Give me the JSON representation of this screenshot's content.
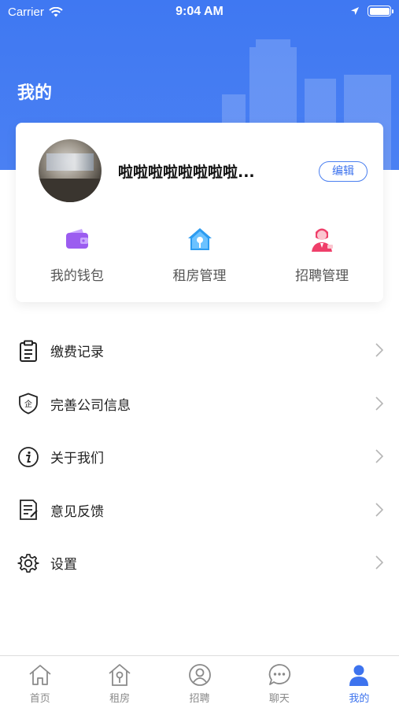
{
  "status_bar": {
    "carrier": "Carrier",
    "time": "9:04 AM"
  },
  "header": {
    "title": "我的"
  },
  "profile": {
    "name": "啦啦啦啦啦啦啦啦...",
    "edit_label": "编辑"
  },
  "quick_actions": [
    {
      "label": "我的钱包",
      "icon": "wallet-icon",
      "color": "#9b5cf0"
    },
    {
      "label": "租房管理",
      "icon": "house-key-icon",
      "color": "#2d9cf0"
    },
    {
      "label": "招聘管理",
      "icon": "recruiter-icon",
      "color": "#ef3f6a"
    }
  ],
  "menu": [
    {
      "label": "缴费记录",
      "icon": "clipboard-icon"
    },
    {
      "label": "完善公司信息",
      "icon": "company-shield-icon"
    },
    {
      "label": "关于我们",
      "icon": "info-icon"
    },
    {
      "label": "意见反馈",
      "icon": "feedback-icon"
    },
    {
      "label": "设置",
      "icon": "gear-icon"
    }
  ],
  "tabbar": [
    {
      "label": "首页",
      "icon": "home-icon",
      "active": false
    },
    {
      "label": "租房",
      "icon": "rent-house-icon",
      "active": false
    },
    {
      "label": "招聘",
      "icon": "recruit-icon",
      "active": false
    },
    {
      "label": "聊天",
      "icon": "chat-icon",
      "active": false
    },
    {
      "label": "我的",
      "icon": "profile-icon",
      "active": true
    }
  ],
  "colors": {
    "header": "#3f78f2",
    "accent": "#3d73ee",
    "inactive_tab": "#8a8a8a"
  }
}
